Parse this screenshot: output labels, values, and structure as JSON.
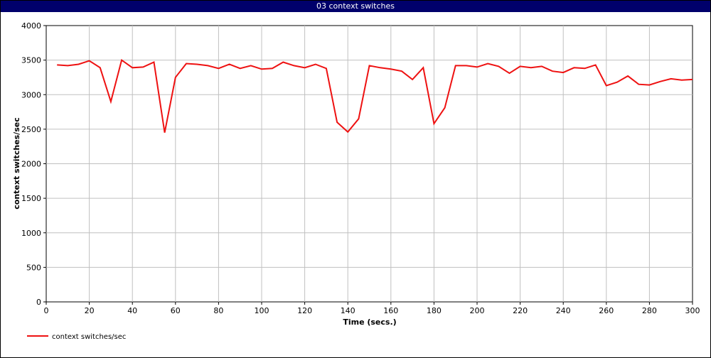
{
  "window": {
    "title": "03 context switches"
  },
  "chart_data": {
    "type": "line",
    "title": "03 context switches",
    "xlabel": "Time (secs.)",
    "ylabel": "context switches/sec",
    "xlim": [
      0,
      300
    ],
    "ylim": [
      0,
      4000
    ],
    "xticks": [
      0,
      20,
      40,
      60,
      80,
      100,
      120,
      140,
      160,
      180,
      200,
      220,
      240,
      260,
      280,
      300
    ],
    "yticks": [
      0,
      500,
      1000,
      1500,
      2000,
      2500,
      3000,
      3500,
      4000
    ],
    "grid": true,
    "legend_position": "bottom-left",
    "series": [
      {
        "name": "context switches/sec",
        "color": "#ee1111",
        "x": [
          5,
          10,
          15,
          20,
          25,
          30,
          35,
          40,
          45,
          50,
          55,
          60,
          65,
          70,
          75,
          80,
          85,
          90,
          95,
          100,
          105,
          110,
          115,
          120,
          125,
          130,
          135,
          140,
          145,
          150,
          155,
          160,
          165,
          170,
          175,
          180,
          185,
          190,
          195,
          200,
          205,
          210,
          215,
          220,
          225,
          230,
          235,
          240,
          245,
          250,
          255,
          260,
          265,
          270,
          275,
          280,
          285,
          290,
          295,
          300
        ],
        "y": [
          3430,
          3420,
          3440,
          3490,
          3390,
          2900,
          3500,
          3390,
          3400,
          3470,
          2450,
          3250,
          3450,
          3440,
          3420,
          3380,
          3440,
          3380,
          3420,
          3370,
          3380,
          3470,
          3420,
          3390,
          3440,
          3380,
          2600,
          2460,
          2650,
          3420,
          3390,
          3370,
          3340,
          3220,
          3390,
          2580,
          2810,
          3420,
          3420,
          3400,
          3450,
          3410,
          3310,
          3410,
          3390,
          3410,
          3340,
          3320,
          3390,
          3380,
          3430,
          3130,
          3180,
          3270,
          3150,
          3140,
          3190,
          3230,
          3210,
          3220
        ]
      }
    ]
  }
}
